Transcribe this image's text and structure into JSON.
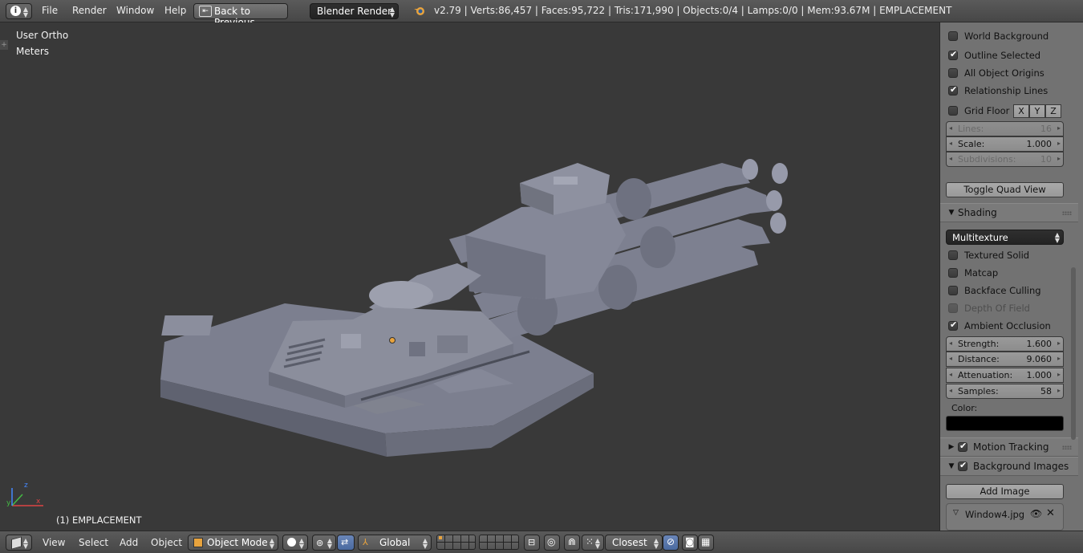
{
  "topbar": {
    "info_icon": "info-icon",
    "menus": [
      "File",
      "Render",
      "Window",
      "Help"
    ],
    "back_button": "Back to Previous",
    "render_engine": "Blender Render",
    "stats": "v2.79 | Verts:86,457 | Faces:95,722 | Tris:171,990 | Objects:0/4 | Lamps:0/0 | Mem:93.67M | EMPLACEMENT"
  },
  "viewport": {
    "view_label": "User Ortho",
    "units_label": "Meters",
    "object_label": "(1) EMPLACEMENT",
    "axis": {
      "x": "x",
      "y": "y",
      "z": "z"
    }
  },
  "panel": {
    "display": {
      "world_background": {
        "label": "World Background",
        "checked": false
      },
      "outline_selected": {
        "label": "Outline Selected",
        "checked": true
      },
      "all_object_origins": {
        "label": "All Object Origins",
        "checked": false
      },
      "relationship_lines": {
        "label": "Relationship Lines",
        "checked": true
      },
      "grid_floor": {
        "label": "Grid Floor",
        "checked": false
      },
      "grid_axes": [
        "X",
        "Y",
        "Z"
      ],
      "lines": {
        "label": "Lines:",
        "value": "16"
      },
      "scale": {
        "label": "Scale:",
        "value": "1.000"
      },
      "subdivisions": {
        "label": "Subdivisions:",
        "value": "10"
      },
      "toggle_quad_view": "Toggle Quad View"
    },
    "shading": {
      "title": "Shading",
      "mode": "Multitexture",
      "textured_solid": {
        "label": "Textured Solid",
        "checked": false
      },
      "matcap": {
        "label": "Matcap",
        "checked": false
      },
      "backface_culling": {
        "label": "Backface Culling",
        "checked": false
      },
      "depth_of_field": {
        "label": "Depth Of Field",
        "checked": false
      },
      "ambient_occlusion": {
        "label": "Ambient Occlusion",
        "checked": true
      },
      "strength": {
        "label": "Strength:",
        "value": "1.600"
      },
      "distance": {
        "label": "Distance:",
        "value": "9.060"
      },
      "attenuation": {
        "label": "Attenuation:",
        "value": "1.000"
      },
      "samples": {
        "label": "Samples:",
        "value": "58"
      },
      "color_label": "Color:",
      "color_value": "#000000"
    },
    "motion_tracking": {
      "title": "Motion Tracking",
      "checked": true
    },
    "background_images": {
      "title": "Background Images",
      "checked": true,
      "add_image": "Add Image",
      "image_name": "Window4.jpg"
    }
  },
  "bottombar": {
    "menus": [
      "View",
      "Select",
      "Add",
      "Object"
    ],
    "mode": "Object Mode",
    "orientation": "Global",
    "snap_target": "Closest"
  },
  "colors": {
    "viewport_bg": "#393939",
    "panel_bg": "#727272",
    "accent_orange": "#e8a33d"
  }
}
